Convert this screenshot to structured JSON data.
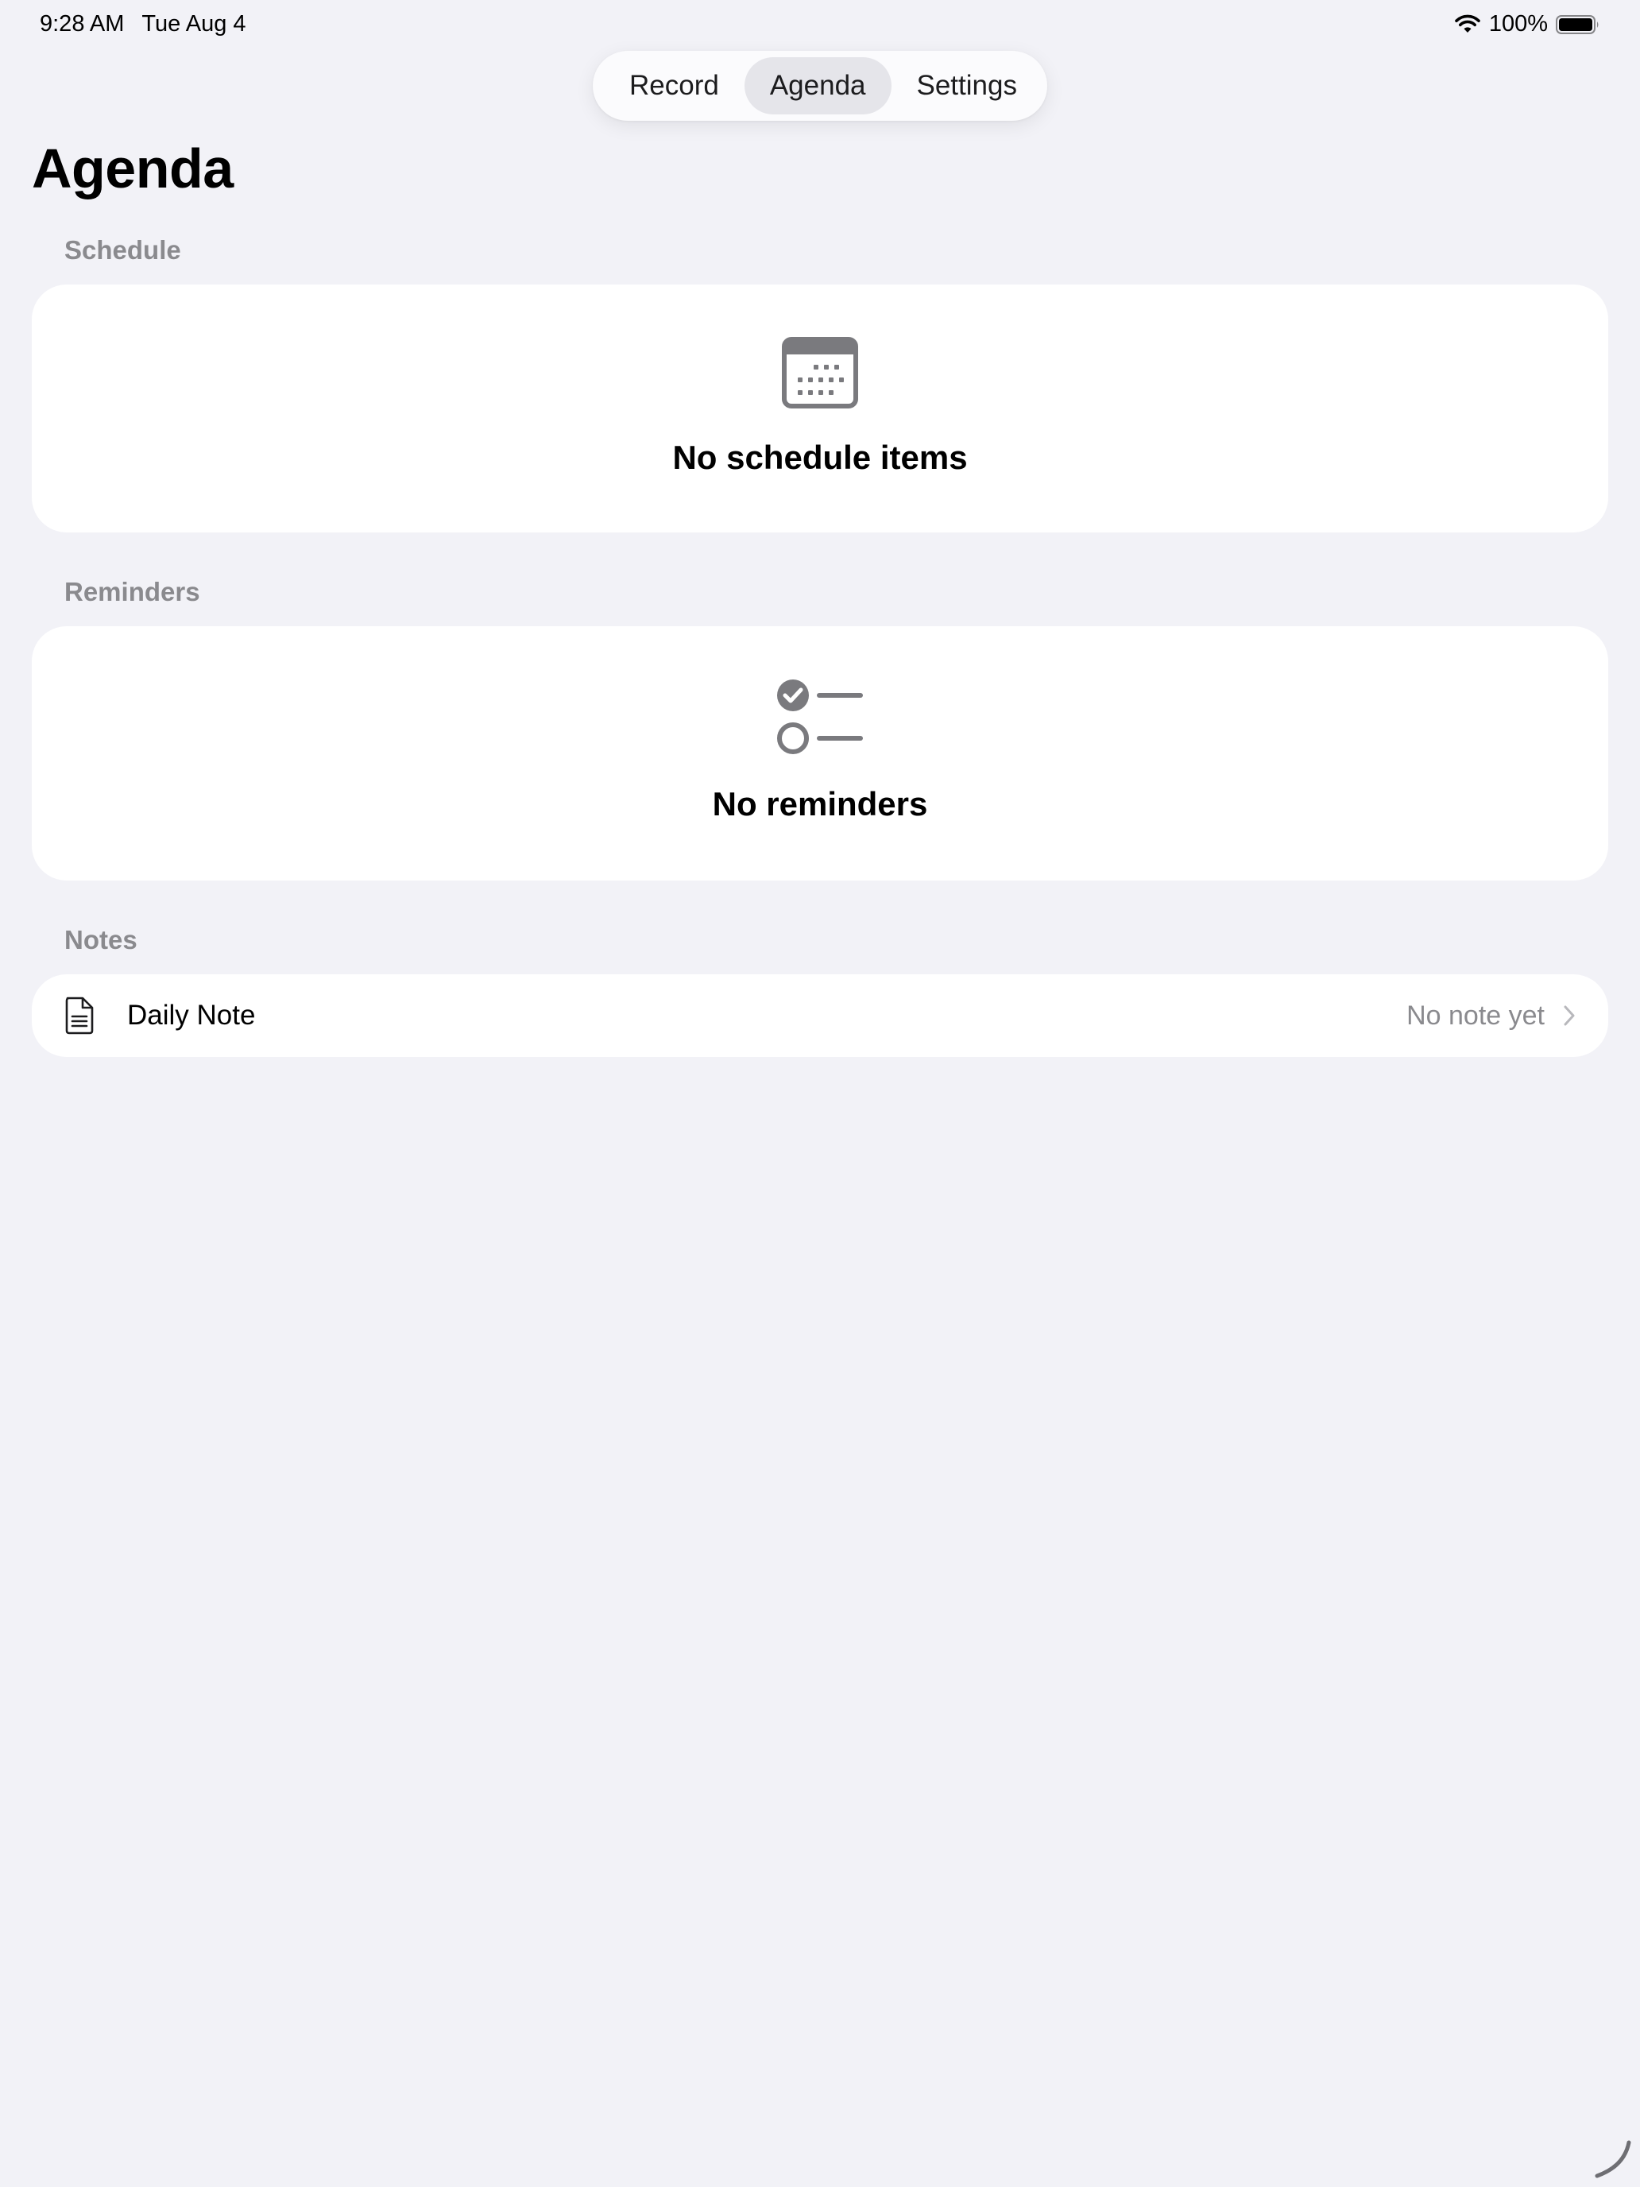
{
  "status_bar": {
    "time": "9:28 AM",
    "date": "Tue Aug 4",
    "battery_percent": "100%",
    "icons": [
      "wifi-icon",
      "battery-icon"
    ]
  },
  "tabs": [
    {
      "label": "Record",
      "active": false
    },
    {
      "label": "Agenda",
      "active": true
    },
    {
      "label": "Settings",
      "active": false
    }
  ],
  "page": {
    "title": "Agenda"
  },
  "schedule": {
    "header": "Schedule",
    "icon": "calendar-icon",
    "empty_text": "No schedule items"
  },
  "reminders": {
    "header": "Reminders",
    "icon": "checklist-icon",
    "empty_text": "No reminders"
  },
  "notes": {
    "header": "Notes",
    "daily_note": {
      "icon": "document-icon",
      "label": "Daily Note",
      "value": "No note yet"
    }
  },
  "colors": {
    "background": "#f2f2f7",
    "card": "#ffffff",
    "secondary_text": "#8a8a8e",
    "icon_gray": "#7a7a7e",
    "active_tab": "#e5e5ea"
  }
}
